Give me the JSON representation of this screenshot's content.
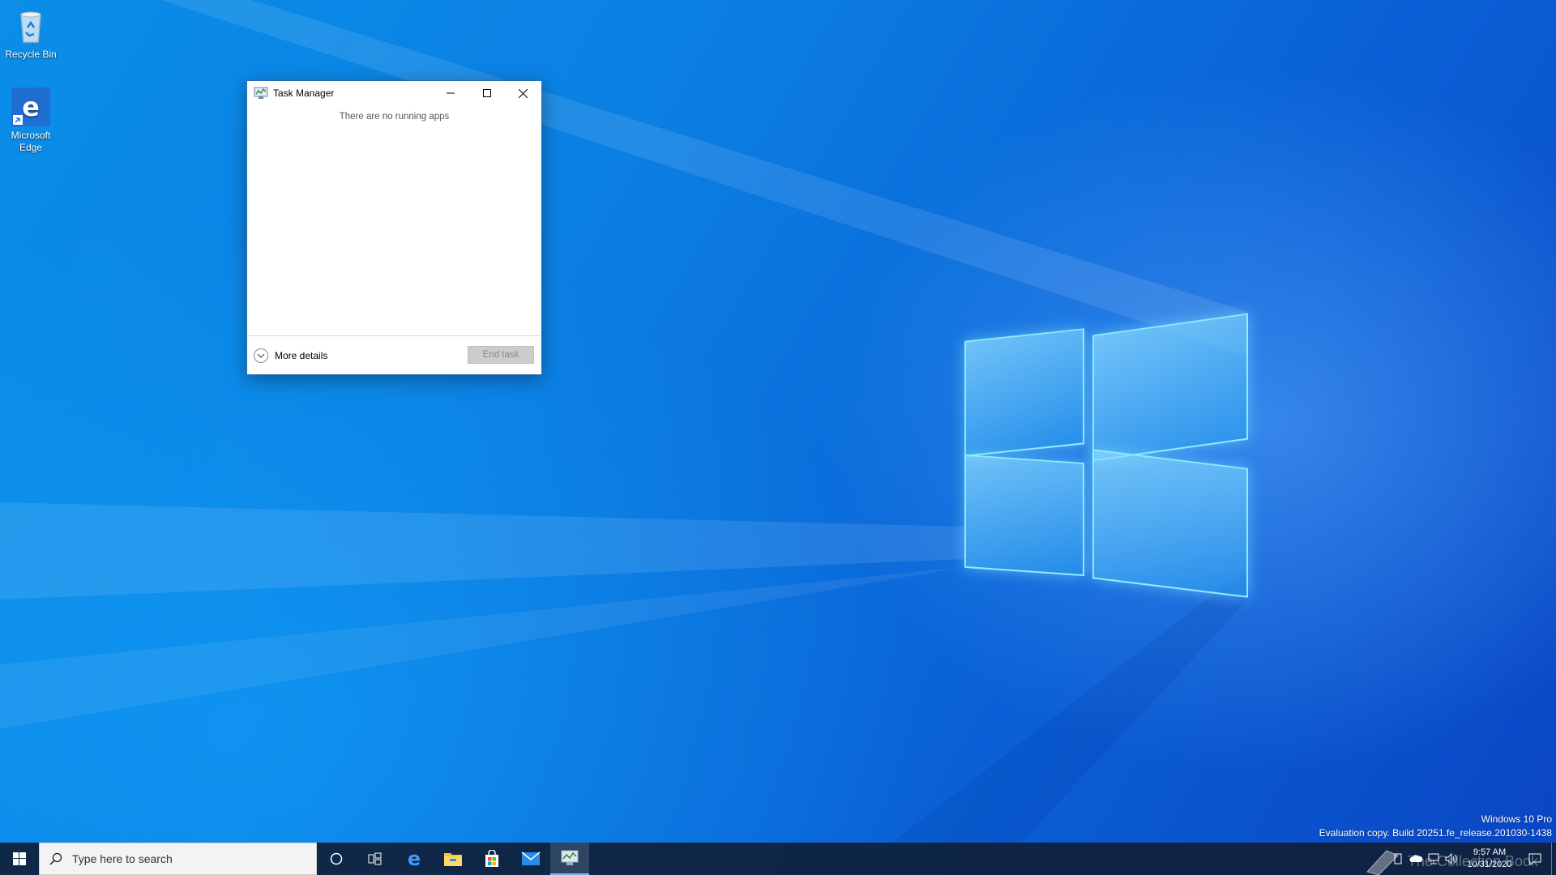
{
  "desktop": {
    "icons": [
      {
        "label": "Recycle Bin",
        "icon": "recycle-bin-icon"
      },
      {
        "label": "Microsoft Edge",
        "icon": "edge-icon"
      }
    ]
  },
  "task_manager": {
    "title": "Task Manager",
    "empty_message": "There are no running apps",
    "more_details_label": "More details",
    "end_task_label": "End task"
  },
  "watermark": {
    "edition": "Windows 10 Pro",
    "build": "Evaluation copy. Build 20251.fe_release.201030-1438"
  },
  "taskbar": {
    "search_placeholder": "Type here to search",
    "pinned": [
      "cortana-icon",
      "task-view-icon",
      "edge-icon",
      "file-explorer-icon",
      "store-icon",
      "mail-icon",
      "task-manager-icon"
    ],
    "active_app": "task-manager-icon"
  },
  "tray": {
    "time": "9:57 AM",
    "date": "10/31/2020"
  },
  "overlay": {
    "brand_text": "The Collection Book"
  },
  "colors": {
    "taskbar": "#10203a",
    "accent": "#0078d7",
    "desktop": "#0a7fe3"
  }
}
